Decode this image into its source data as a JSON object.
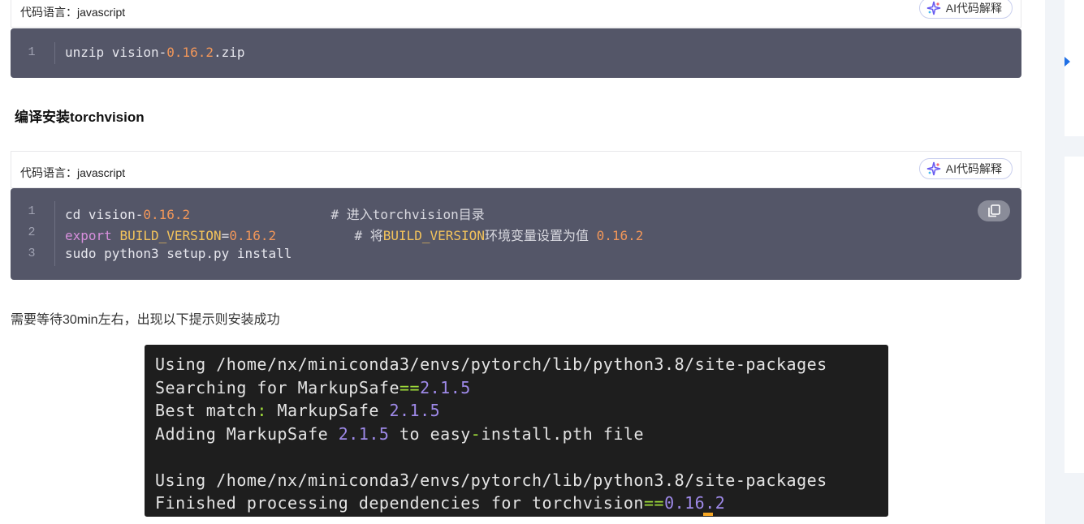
{
  "code_blocks": [
    {
      "lang_label": "代码语言：javascript",
      "ai_label": "AI代码解释",
      "lines": [
        {
          "num": "1",
          "parts": [
            {
              "t": "unzip vision-",
              "c": ""
            },
            {
              "t": "0.16.2",
              "c": "num"
            },
            {
              "t": ".zip",
              "c": ""
            }
          ]
        }
      ]
    },
    {
      "lang_label": "代码语言：javascript",
      "ai_label": "AI代码解释",
      "copy_icon": "copy-icon",
      "lines": [
        {
          "num": "1",
          "parts": [
            {
              "t": "cd vision-",
              "c": ""
            },
            {
              "t": "0.16.2",
              "c": "num"
            },
            {
              "t": "                  # 进入torchvision目录",
              "c": "cmt"
            }
          ]
        },
        {
          "num": "2",
          "parts": [
            {
              "t": "export",
              "c": "kw"
            },
            {
              "t": " ",
              "c": ""
            },
            {
              "t": "BUILD_VERSION",
              "c": "var"
            },
            {
              "t": "=",
              "c": ""
            },
            {
              "t": "0.16.2",
              "c": "num"
            },
            {
              "t": "          # 将",
              "c": "cmt"
            },
            {
              "t": "BUILD_VERSION",
              "c": "var"
            },
            {
              "t": "环境变量设置为值 ",
              "c": "cmt"
            },
            {
              "t": "0.16.2",
              "c": "num"
            }
          ]
        },
        {
          "num": "3",
          "parts": [
            {
              "t": "sudo python3 setup.py install",
              "c": ""
            }
          ]
        }
      ]
    }
  ],
  "heading": "编译安装torchvision",
  "paragraph": "需要等待30min左右，出现以下提示则安装成功",
  "terminal": {
    "lines": [
      [
        {
          "t": "Using /home/nx/miniconda3/envs/pytorch/lib/python3.8/site-packages",
          "c": ""
        }
      ],
      [
        {
          "t": "Searching for MarkupSafe",
          "c": ""
        },
        {
          "t": "==",
          "c": "teq"
        },
        {
          "t": "2.1.5",
          "c": "tver"
        }
      ],
      [
        {
          "t": "Best match",
          "c": ""
        },
        {
          "t": ":",
          "c": "teq"
        },
        {
          "t": " MarkupSafe ",
          "c": ""
        },
        {
          "t": "2.1.5",
          "c": "tver"
        }
      ],
      [
        {
          "t": "Adding MarkupSafe ",
          "c": ""
        },
        {
          "t": "2.1.5",
          "c": "tver"
        },
        {
          "t": " to easy",
          "c": ""
        },
        {
          "t": "-",
          "c": "teq"
        },
        {
          "t": "install.pth file",
          "c": ""
        }
      ],
      [
        {
          "t": "",
          "c": ""
        }
      ],
      [
        {
          "t": "Using /home/nx/miniconda3/envs/pytorch/lib/python3.8/site-packages",
          "c": ""
        }
      ],
      [
        {
          "t": "Finished processing dependencies for torchvision",
          "c": ""
        },
        {
          "t": "==",
          "c": "teq"
        },
        {
          "t": "0.16.2",
          "c": "tver"
        }
      ]
    ]
  },
  "colors": {
    "code_bg": "#545668",
    "number": "#f19659",
    "keyword": "#d78fdc",
    "variable": "#f3c35b",
    "terminal_bg": "#1e1e1e",
    "terminal_version": "#9e89e8",
    "terminal_operator": "#9fdc3a",
    "rail_accent": "#1f6fe5"
  }
}
